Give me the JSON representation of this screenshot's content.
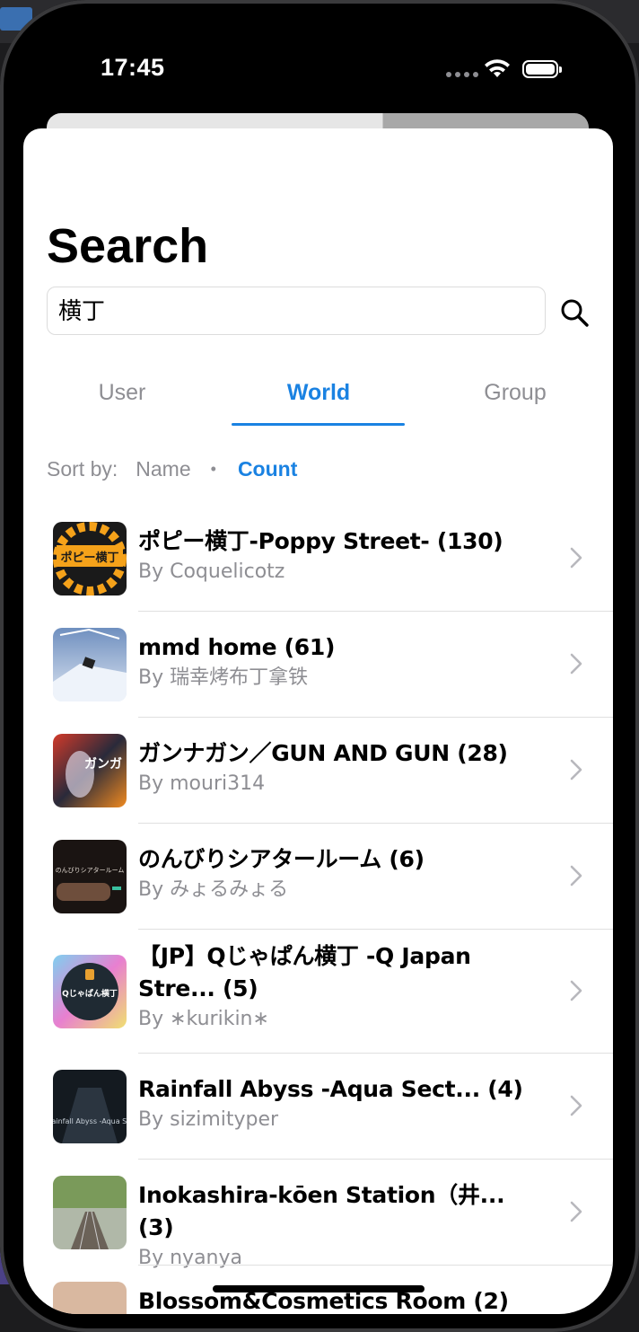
{
  "status": {
    "time": "17:45"
  },
  "page": {
    "title": "Search"
  },
  "search": {
    "value": "横丁"
  },
  "tabs": [
    {
      "label": "User",
      "active": false
    },
    {
      "label": "World",
      "active": true
    },
    {
      "label": "Group",
      "active": false
    }
  ],
  "sort": {
    "label": "Sort by:",
    "name": "Name",
    "separator": "•",
    "count": "Count",
    "selected": "Count"
  },
  "results": [
    {
      "name": "ポピー横丁-Poppy Street- (130)",
      "author": "By Coquelicotz",
      "thumb_text": "ポピー横丁",
      "colors": [
        "#f5a21a",
        "#1a1a1a"
      ]
    },
    {
      "name": "mmd home (61)",
      "author": "By 瑞幸烤布丁拿铁",
      "thumb_text": "",
      "colors": [
        "#c8d6ea",
        "#6f8fbf"
      ]
    },
    {
      "name": "ガンナガン／GUN AND GUN (28)",
      "author": "By mouri314",
      "thumb_text": "ガンガ",
      "colors": [
        "#b01e2a",
        "#2a2a3a"
      ]
    },
    {
      "name": "のんびりシアタールーム (6)",
      "author": "By みょるみょる",
      "thumb_text": "のんびりシアタールーム",
      "colors": [
        "#3a2a22",
        "#1a1412"
      ]
    },
    {
      "name": "【JP】Qじゃぱん横丁 -Q Japan Stre... (5)",
      "author": "By ∗kurikin∗",
      "thumb_text": "Qじゃぱん横丁",
      "colors": [
        "#1f2a33",
        "#e87fd0"
      ]
    },
    {
      "name": "Rainfall Abyss -Aqua Sect... (4)",
      "author": "By sizimityper",
      "thumb_text": "Rainfall Abyss -Aqua Sector",
      "colors": [
        "#2b3540",
        "#141a20"
      ]
    },
    {
      "name": "Inokashira-kōen Station（井... (3)",
      "author": "By nyanya",
      "thumb_text": "",
      "colors": [
        "#7a9a5a",
        "#b0b8a8"
      ]
    },
    {
      "name": "Blossom&Cosmetics Room (2)",
      "author": "",
      "thumb_text": "",
      "colors": [
        "#d9b8a0",
        "#c9a088"
      ]
    }
  ]
}
